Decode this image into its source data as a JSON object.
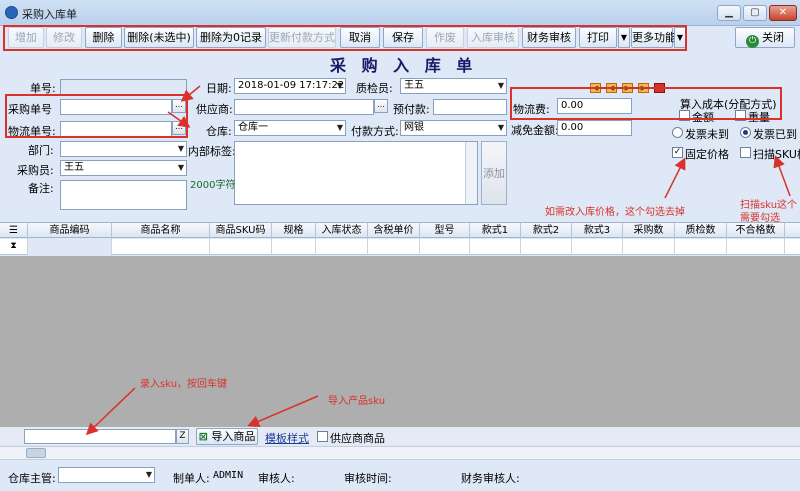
{
  "window": {
    "title": "采购入库单",
    "min_label": "▁",
    "max_label": "▢",
    "close_label": "✕"
  },
  "toolbar": {
    "buttons": [
      {
        "label": "增加",
        "enabled": false
      },
      {
        "label": "修改",
        "enabled": false
      },
      {
        "label": "删除",
        "enabled": true
      },
      {
        "label": "删除(未选中)",
        "enabled": true
      },
      {
        "label": "删除为0记录",
        "enabled": true
      },
      {
        "label": "更新付款方式",
        "enabled": false
      },
      {
        "label": "取消",
        "enabled": true
      },
      {
        "label": "保存",
        "enabled": true
      },
      {
        "label": "作废",
        "enabled": false
      },
      {
        "label": "入库审核",
        "enabled": false
      },
      {
        "label": "财务审核",
        "enabled": true
      },
      {
        "label": "打印",
        "enabled": true
      },
      {
        "label": "更多功能",
        "enabled": true
      }
    ],
    "close_label": "关闭"
  },
  "form": {
    "title": "采 购 入 库 单",
    "labels": {
      "order_no": "单号:",
      "purchase_no": "采购单号",
      "logistics_no": "物流单号:",
      "dept": "部门:",
      "buyer": "采购员:",
      "remark": "备注:",
      "date": "日期:",
      "supplier": "供应商:",
      "warehouse": "仓库:",
      "internal_tag": "内部标签:",
      "inspector": "质检员:",
      "prepay": "预付款:",
      "pay_method": "付款方式:",
      "freight": "物流费:",
      "discount": "减免金额:",
      "cost_group": "算入成本(分配方式)",
      "amount": "金额",
      "weight": "重量",
      "char_limit": "2000字符",
      "add": "添加"
    },
    "values": {
      "order_no": "",
      "date": "2018-01-09 17:17:22",
      "inspector": "王五",
      "supplier": "",
      "prepay": "",
      "warehouse": "仓库一",
      "pay_method": "网银",
      "buyer": "王五",
      "freight": "0.00",
      "discount": "0.00",
      "ellipsis": "…",
      "arrow": "▼"
    },
    "options": {
      "invoice_not_arrived": "发票未到",
      "invoice_arrived": "发票已到",
      "fixed_price": "固定价格",
      "scan_sku": "扫描SKU模式"
    },
    "checks": {
      "fixed_price": "✓"
    },
    "nav_buttons": [
      "◀",
      "◀",
      "▶",
      "▶"
    ]
  },
  "annotations": {
    "fixed_price_note": "如需改入库价格，这个勾选去掉",
    "scan_note_line1": "扫描sku这个",
    "scan_note_line2": "需要勾选",
    "sku_enter_note": "录入sku，按回车键",
    "import_note": "导入产品sku"
  },
  "grid": {
    "columns": [
      "商品编码",
      "商品名称",
      "商品SKU码",
      "规格",
      "入库状态",
      "含税单价",
      "型号",
      "款式1",
      "款式2",
      "款式3",
      "采购数",
      "质检数",
      "不合格数"
    ],
    "row_marker": "☰",
    "filter_marker": "⧗"
  },
  "bottom": {
    "z_label": "Z",
    "import_button": "导入商品",
    "template_link": "模板样式",
    "supplier_goods": "供应商商品"
  },
  "footer": {
    "warehouse_manager": "仓库主管:",
    "maker": "制单人:",
    "maker_value": "ADMIN",
    "auditor": "审核人:",
    "audit_time": "审核时间:",
    "finance_auditor": "财务审核人:"
  }
}
